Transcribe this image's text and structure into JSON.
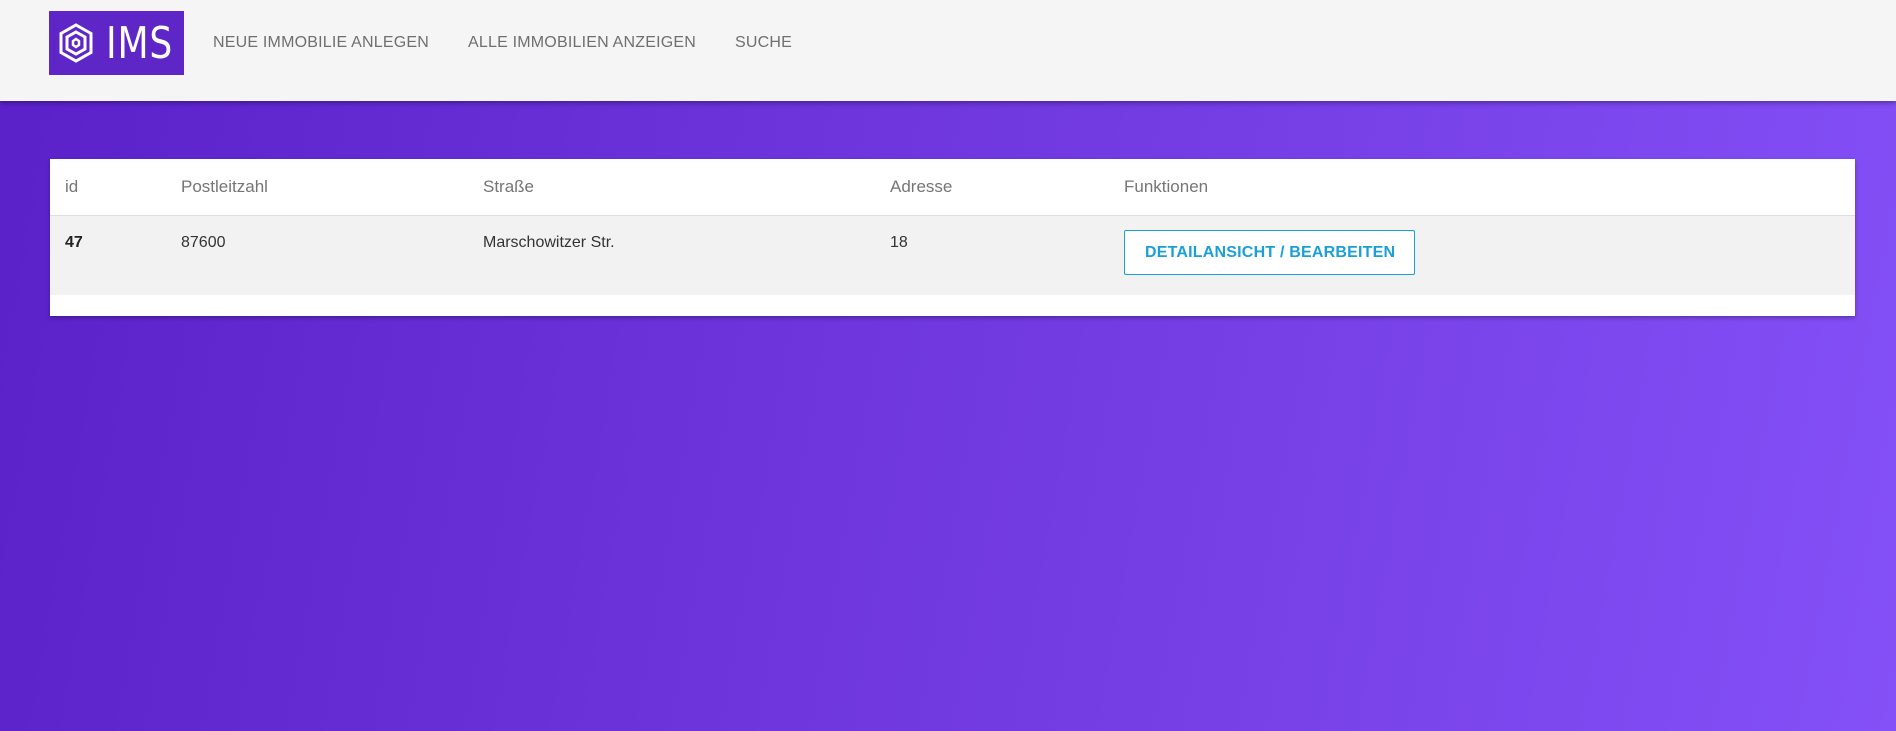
{
  "header": {
    "logo_text": "IMS",
    "nav": [
      {
        "label": "NEUE IMMOBILIE ANLEGEN"
      },
      {
        "label": "ALLE IMMOBILIEN ANZEIGEN"
      },
      {
        "label": "SUCHE"
      }
    ]
  },
  "table": {
    "columns": [
      "id",
      "Postleitzahl",
      "Straße",
      "Adresse",
      "Funktionen"
    ],
    "rows": [
      {
        "id": "47",
        "postleitzahl": "87600",
        "strasse": "Marschowitzer Str.",
        "adresse": "18",
        "action_label": "DETAILANSICHT / BEARBEITEN"
      }
    ]
  },
  "colors": {
    "brand": "#5e26c6",
    "gradient_start": "#5b21c9",
    "gradient_end": "#8450f7",
    "button_accent": "#1aa0d8"
  }
}
